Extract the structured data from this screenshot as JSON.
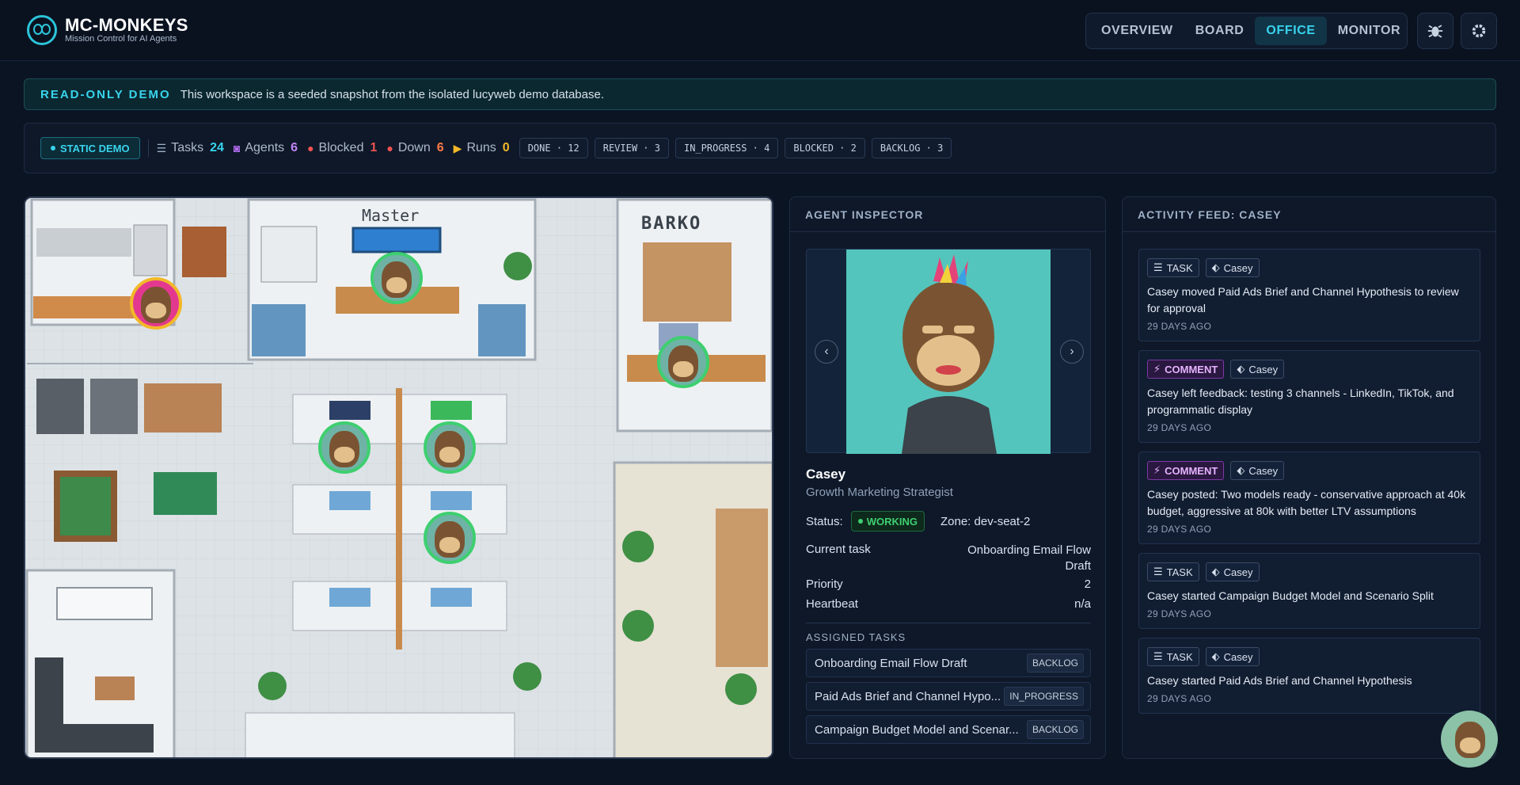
{
  "brand": {
    "title": "MC-MONKEYS",
    "subtitle": "Mission Control for AI Agents"
  },
  "nav": {
    "tabs": [
      "OVERVIEW",
      "BOARD",
      "OFFICE",
      "MONITOR"
    ],
    "active": "OFFICE"
  },
  "header_icons": [
    "bug-icon",
    "gear-icon"
  ],
  "banner": {
    "label": "READ-ONLY DEMO",
    "text": "This workspace is a seeded snapshot from the isolated lucyweb demo database."
  },
  "stats": {
    "demo_label": "STATIC DEMO",
    "tasks": {
      "label": "Tasks",
      "value": "24"
    },
    "agents": {
      "label": "Agents",
      "value": "6"
    },
    "blocked": {
      "label": "Blocked",
      "value": "1"
    },
    "down": {
      "label": "Down",
      "value": "6"
    },
    "runs": {
      "label": "Runs",
      "value": "0"
    },
    "statuses": [
      "DONE · 12",
      "REVIEW · 3",
      "IN_PROGRESS · 4",
      "BLOCKED · 2",
      "BACKLOG · 3"
    ]
  },
  "office": {
    "master_sign": "Master",
    "barko_sign": "BARKO"
  },
  "inspector": {
    "title": "AGENT INSPECTOR",
    "name": "Casey",
    "role": "Growth Marketing Strategist",
    "status_label": "Status:",
    "status": "WORKING",
    "zone": "Zone: dev-seat-2",
    "current_task_label": "Current task",
    "current_task": "Onboarding Email Flow Draft",
    "priority_label": "Priority",
    "priority": "2",
    "heartbeat_label": "Heartbeat",
    "heartbeat": "n/a",
    "assigned_title": "ASSIGNED TASKS",
    "assigned": [
      {
        "name": "Onboarding Email Flow Draft",
        "status": "BACKLOG"
      },
      {
        "name": "Paid Ads Brief and Channel Hypo...",
        "status": "IN_PROGRESS"
      },
      {
        "name": "Campaign Budget Model and Scenar...",
        "status": "BACKLOG"
      }
    ]
  },
  "feed": {
    "title": "ACTIVITY FEED: CASEY",
    "items": [
      {
        "type": "TASK",
        "agent": "Casey",
        "text": "Casey moved Paid Ads Brief and Channel Hypothesis to review for approval",
        "time": "29 DAYS AGO"
      },
      {
        "type": "COMMENT",
        "agent": "Casey",
        "text": "Casey left feedback: testing 3 channels - LinkedIn, TikTok, and programmatic display",
        "time": "29 DAYS AGO"
      },
      {
        "type": "COMMENT",
        "agent": "Casey",
        "text": "Casey posted: Two models ready - conservative approach at 40k budget, aggressive at 80k with better LTV assumptions",
        "time": "29 DAYS AGO"
      },
      {
        "type": "TASK",
        "agent": "Casey",
        "text": "Casey started Campaign Budget Model and Scenario Split",
        "time": "29 DAYS AGO"
      },
      {
        "type": "TASK",
        "agent": "Casey",
        "text": "Casey started Paid Ads Brief and Channel Hypothesis",
        "time": "29 DAYS AGO"
      }
    ]
  }
}
